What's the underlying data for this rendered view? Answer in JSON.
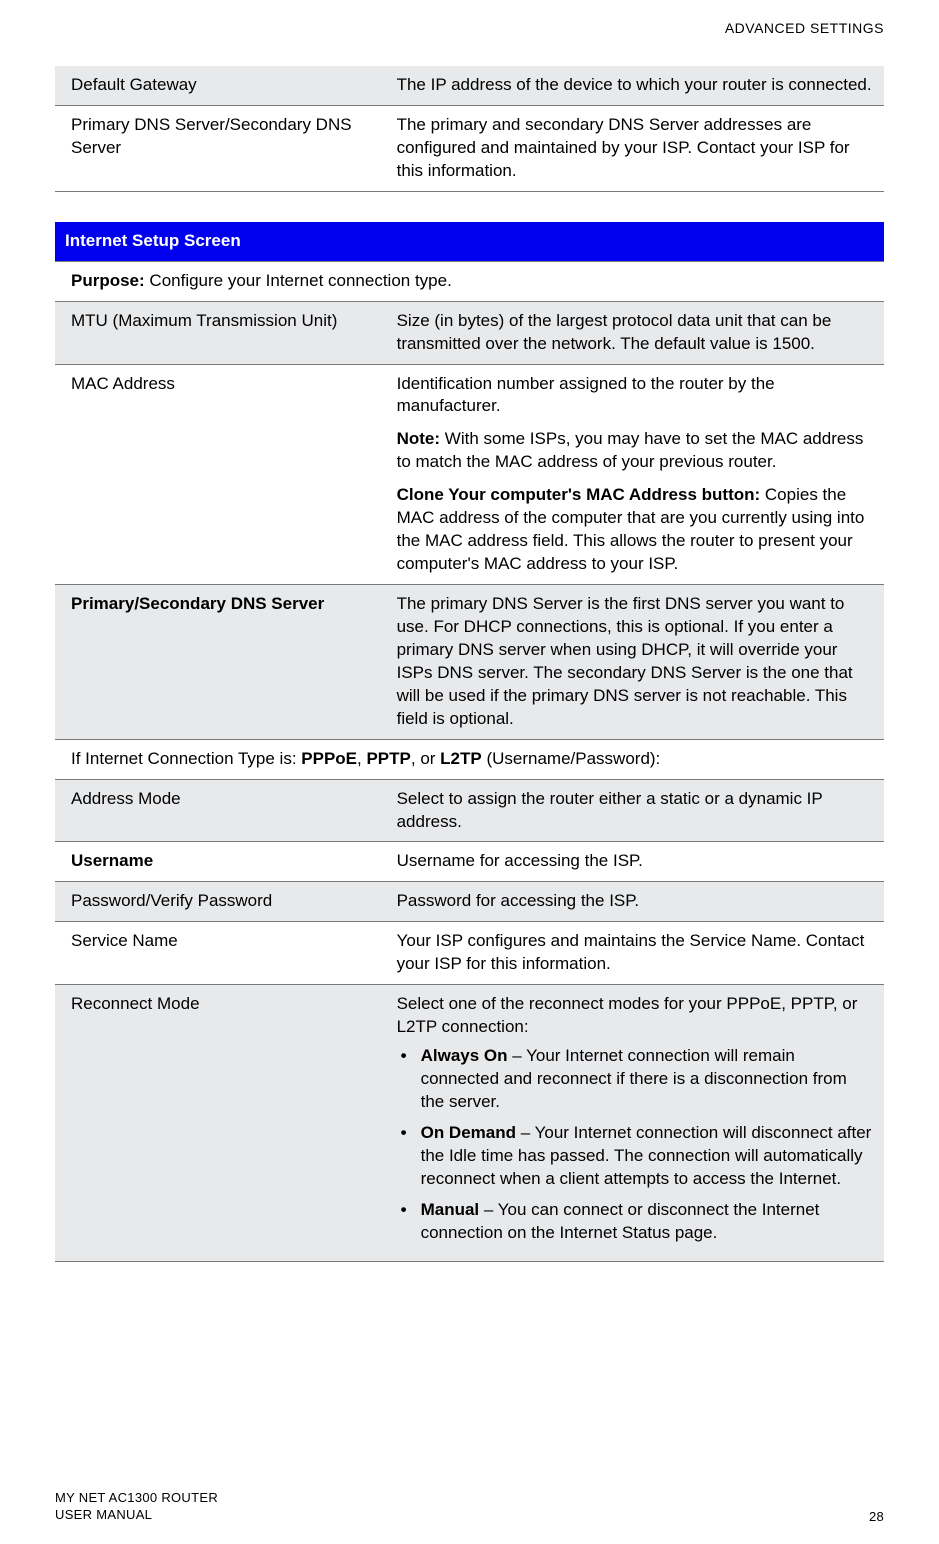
{
  "header": {
    "section": "ADVANCED SETTINGS"
  },
  "table1": {
    "rows": [
      {
        "shaded": true,
        "left": "Default Gateway",
        "right": "The IP address of the device to which your router is connected."
      },
      {
        "shaded": false,
        "left": "Primary DNS Server/Secondary DNS Server",
        "right": "The primary and secondary DNS Server addresses are configured and maintained by your ISP. Contact your ISP for this information."
      }
    ]
  },
  "table2": {
    "title": "Internet Setup Screen",
    "purpose_label": "Purpose:",
    "purpose_text": " Configure your Internet connection type.",
    "mtu": {
      "left": "MTU (Maximum Transmission Unit)",
      "right": "Size (in bytes) of the largest protocol data unit that can be transmitted over the network. The default value is 1500."
    },
    "mac": {
      "left": "MAC Address",
      "p1": "Identification number assigned to the router by the manufacturer.",
      "note_label": "Note:",
      "note_text": " With some ISPs, you may have to set the MAC address to match the MAC address of your previous router.",
      "clone_label": "Clone Your computer's MAC Address button:",
      "clone_text": " Copies the MAC address of the computer that are you currently using into the MAC address field. This allows the router to present your computer's MAC address to your ISP."
    },
    "dns": {
      "left": "Primary/Secondary DNS Server",
      "right": "The primary DNS Server is the first DNS server you want to use. For DHCP connections, this is optional. If you enter a primary DNS server when using DHCP, it will override your ISPs DNS server. The secondary DNS Server is the one that will be used if the primary DNS server is not reachable. This field is optional."
    },
    "conn_type": {
      "pre": "If Internet Connection Type is: ",
      "b1": "PPPoE",
      "sep1": ", ",
      "b2": "PPTP",
      "sep2": ", or ",
      "b3": "L2TP",
      "post": " (Username/Password):"
    },
    "addrmode": {
      "left": "Address Mode",
      "right": "Select to assign the router either a static or a dynamic IP address."
    },
    "username": {
      "left": "Username",
      "right": "Username for accessing the ISP."
    },
    "password": {
      "left": "Password/Verify Password",
      "right": "Password for accessing the ISP."
    },
    "service": {
      "left": "Service Name",
      "right": "Your ISP configures and maintains the Service Name. Contact your ISP for this information."
    },
    "reconnect": {
      "left": "Reconnect Mode",
      "intro": "Select one of the reconnect modes for your PPPoE, PPTP, or L2TP connection:",
      "b1_label": "Always On",
      "b1_text": " – Your Internet connection will remain connected and reconnect if there is a disconnection from the server.",
      "b2_label": "On Demand",
      "b2_text": " – Your Internet connection will disconnect after the Idle time has passed. The connection will automatically reconnect when a client attempts to access the Internet.",
      "b3_label": "Manual",
      "b3_text": " – You can connect or disconnect the Internet connection on the Internet Status page."
    }
  },
  "footer": {
    "line1": "MY NET AC1300 ROUTER",
    "line2": "USER MANUAL",
    "page": "28"
  }
}
